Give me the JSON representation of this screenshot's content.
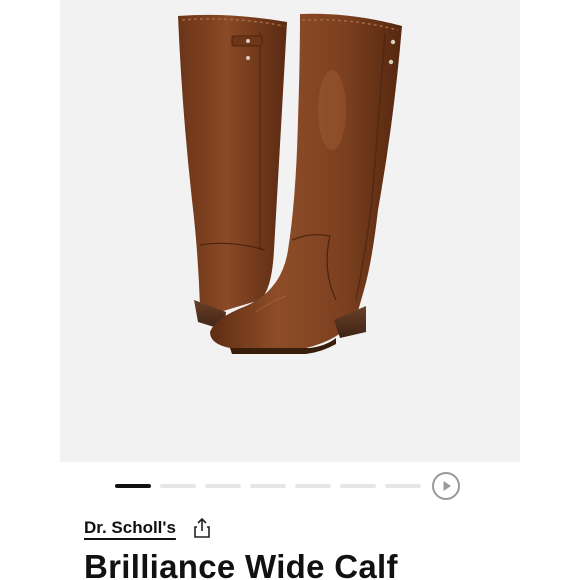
{
  "product": {
    "brand": "Dr. Scholl's",
    "title": "Brilliance Wide Calf"
  },
  "gallery": {
    "image_alt": "brown knee-high boots",
    "dot_count": 7,
    "active_index": 0,
    "icons": {
      "play": "play-icon",
      "share": "share-icon"
    }
  },
  "colors": {
    "image_background": "#f2f2f2",
    "boot_leather": "#7a3f1f",
    "active_dot": "#111111",
    "inactive_dot": "#e6e6e6",
    "text": "#111111"
  }
}
